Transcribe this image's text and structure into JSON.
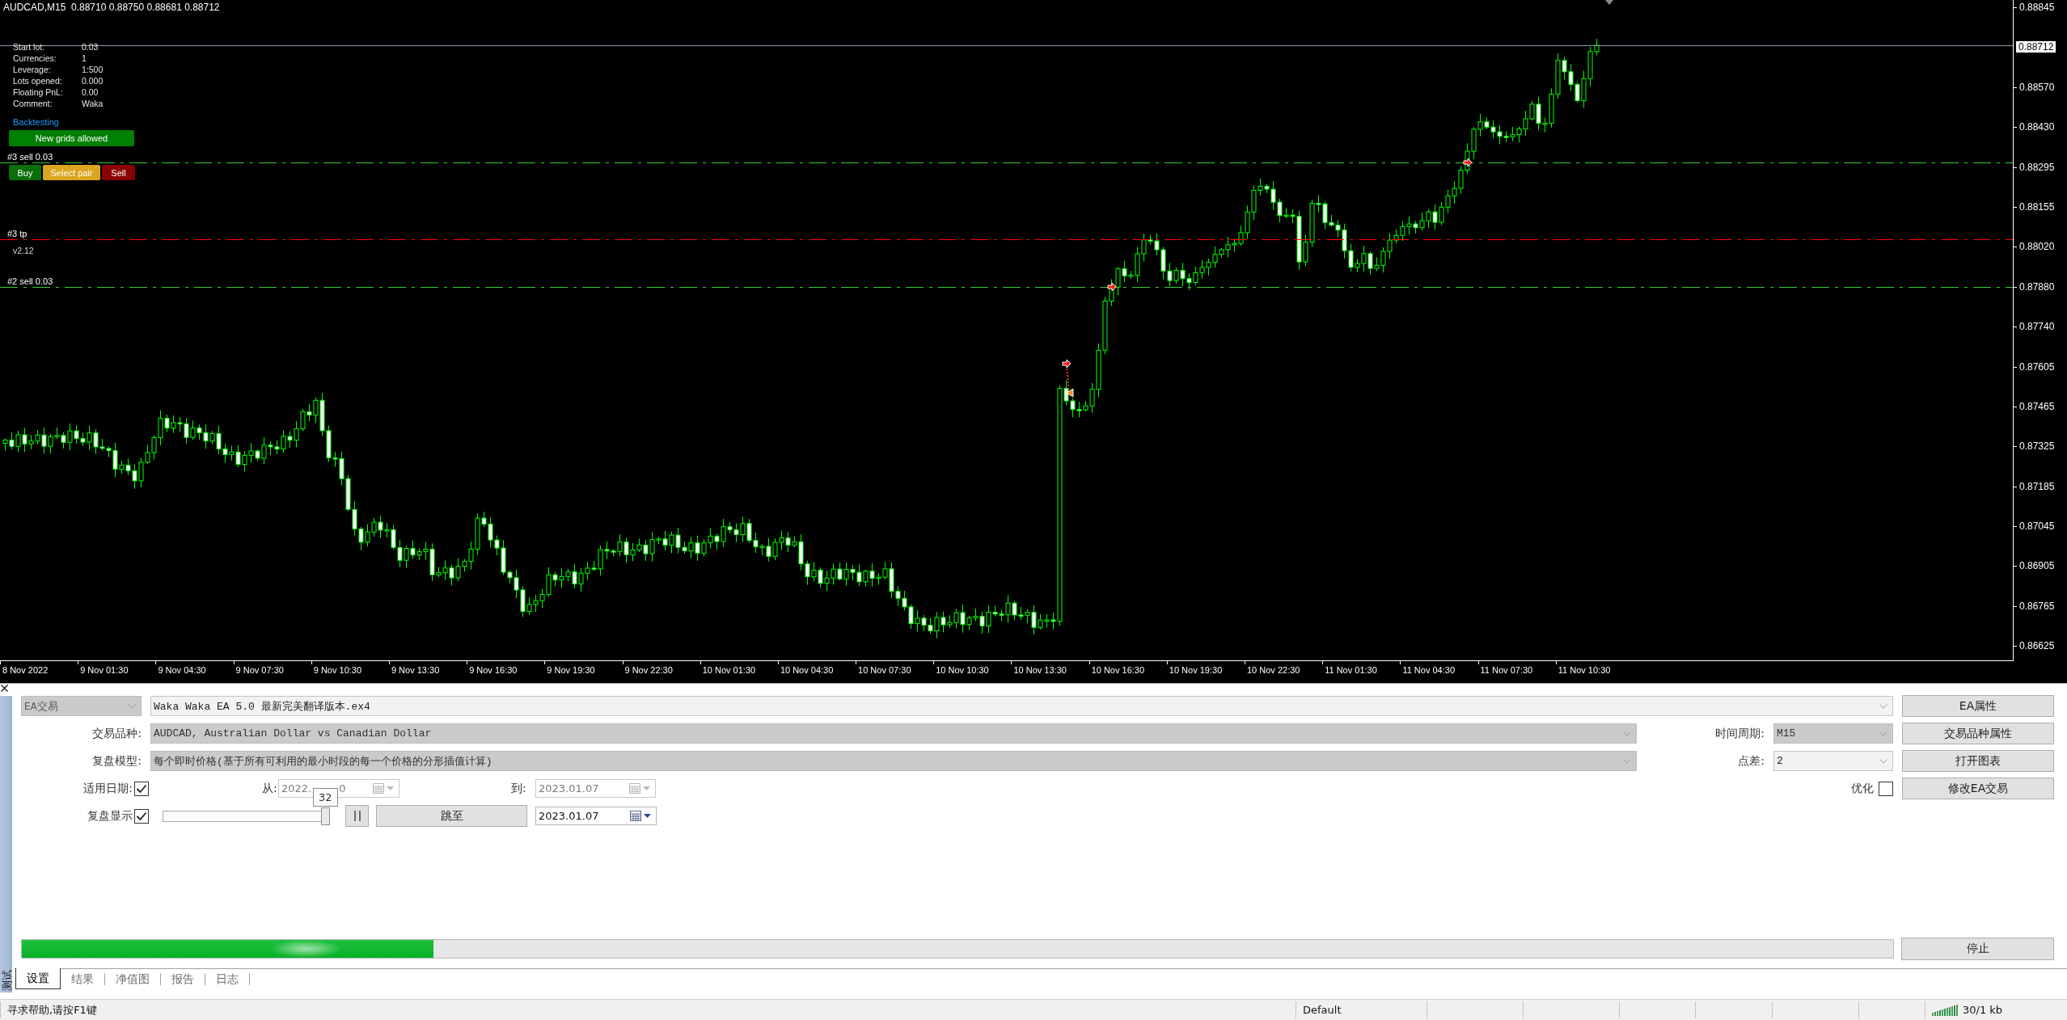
{
  "chart": {
    "header": "AUDCAD,M15  0.88710 0.88750 0.88681 0.88712",
    "info_rows": [
      {
        "label": "Start lot:",
        "value": "0.03"
      },
      {
        "label": "Currencies:",
        "value": "1"
      },
      {
        "label": "Leverage:",
        "value": "1:500"
      },
      {
        "label": "Lots opened:",
        "value": "0.000"
      },
      {
        "label": "Floating PnL:",
        "value": "0.00"
      },
      {
        "label": "Comment:",
        "value": "Waka"
      }
    ],
    "mode_label": "Backtesting",
    "grid_button": "New grids allowed",
    "trade_buttons": [
      {
        "label": "Buy",
        "kind": "buy"
      },
      {
        "label": "Select pair",
        "kind": "select"
      },
      {
        "label": "Sell",
        "kind": "sell"
      }
    ],
    "order_lines": [
      {
        "label": "#3 sell 0.03",
        "kind": "sell"
      },
      {
        "label": "#3 tp",
        "kind": "tp"
      },
      {
        "label": "#2 sell 0.03",
        "kind": "sell"
      }
    ],
    "version": "v2.12",
    "price_axis": [
      {
        "text": "0.88845",
        "current": false
      },
      {
        "text": "0.88712",
        "current": true
      },
      {
        "text": "0.88570",
        "current": false
      },
      {
        "text": "0.88430",
        "current": false
      },
      {
        "text": "0.88295",
        "current": false
      },
      {
        "text": "0.88155",
        "current": false
      },
      {
        "text": "0.88020",
        "current": false
      },
      {
        "text": "0.87880",
        "current": false
      },
      {
        "text": "0.87740",
        "current": false
      },
      {
        "text": "0.87605",
        "current": false
      },
      {
        "text": "0.87465",
        "current": false
      },
      {
        "text": "0.87325",
        "current": false
      },
      {
        "text": "0.87185",
        "current": false
      },
      {
        "text": "0.87045",
        "current": false
      },
      {
        "text": "0.86905",
        "current": false
      },
      {
        "text": "0.86765",
        "current": false
      },
      {
        "text": "0.86625",
        "current": false
      }
    ],
    "time_axis": [
      "8 Nov 2022",
      "9 Nov 01:30",
      "9 Nov 04:30",
      "9 Nov 07:30",
      "9 Nov 10:30",
      "9 Nov 13:30",
      "9 Nov 16:30",
      "9 Nov 19:30",
      "9 Nov 22:30",
      "10 Nov 01:30",
      "10 Nov 04:30",
      "10 Nov 07:30",
      "10 Nov 10:30",
      "10 Nov 13:30",
      "10 Nov 16:30",
      "10 Nov 19:30",
      "10 Nov 22:30",
      "11 Nov 01:30",
      "11 Nov 04:30",
      "11 Nov 07:30",
      "11 Nov 10:30"
    ]
  },
  "tester": {
    "panel_title": "测试",
    "expert_type": {
      "value": "EA交易",
      "disabled": true
    },
    "expert_file": {
      "value": "Waka Waka EA 5.0 最新完美翻译版本.ex4",
      "disabled": false
    },
    "symbol": {
      "label": "交易品种:",
      "value": "AUDCAD, Australian Dollar vs Canadian Dollar",
      "disabled": true
    },
    "period": {
      "label": "时间周期:",
      "value": "M15",
      "disabled": true
    },
    "model": {
      "label": "复盘模型:",
      "value": "每个即时价格(基于所有可利用的最小时段的每一个价格的分形插值计算)",
      "disabled": true
    },
    "spread": {
      "label": "点差:",
      "value": "2",
      "disabled": false
    },
    "use_date": {
      "label": "适用日期:",
      "checked": true
    },
    "date_from": {
      "label": "从:",
      "value_parts": [
        "2022.",
        "0"
      ],
      "disabled": true
    },
    "date_to": {
      "label": "到:",
      "value": "2023.01.07",
      "disabled": true
    },
    "optimization": {
      "label": "优化",
      "checked": false
    },
    "visual_mode": {
      "label": "复盘显示",
      "checked": true
    },
    "speed": {
      "level": 1,
      "tooltip": "32"
    },
    "skip_button": "跳至",
    "skip_to_date": {
      "value": "2023.01.07",
      "disabled": false
    },
    "side_buttons": [
      "EA属性",
      "交易品种属性",
      "打开图表",
      "修改EA交易"
    ],
    "progress": {
      "level": 0.22
    },
    "stop_button": "停止",
    "tabs": [
      {
        "label": "设置",
        "selected": true
      },
      {
        "label": "结果",
        "selected": false
      },
      {
        "label": "净值图",
        "selected": false
      },
      {
        "label": "报告",
        "selected": false
      },
      {
        "label": "日志",
        "selected": false
      }
    ]
  },
  "status_bar": {
    "help": "寻求帮助,请按F1键",
    "profile": "Default",
    "traffic": "30/1 kb"
  }
}
